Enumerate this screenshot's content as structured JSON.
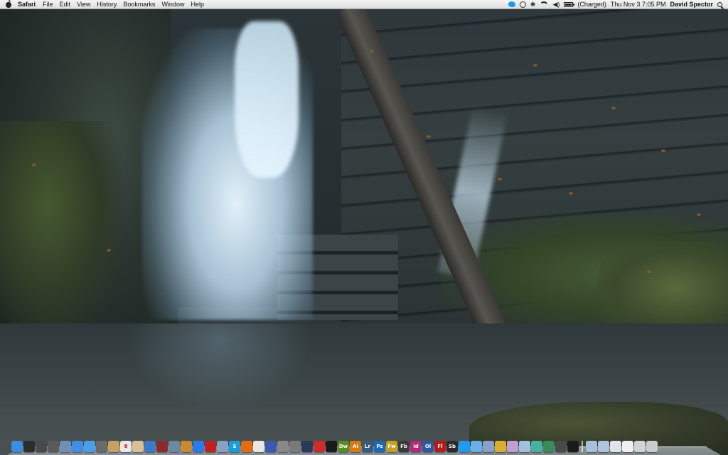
{
  "menubar": {
    "app_name": "Safari",
    "menus": [
      "File",
      "Edit",
      "View",
      "History",
      "Bookmarks",
      "Window",
      "Help"
    ],
    "status": {
      "battery_text": "(Charged)",
      "clock": "Thu Nov 3  7:05 PM",
      "user": "David Spector"
    }
  },
  "dock": {
    "apps": [
      {
        "name": "finder-icon",
        "label": "",
        "color": "#3a8de0"
      },
      {
        "name": "dashboard-icon",
        "label": "",
        "color": "#2d2d2d"
      },
      {
        "name": "mission-control-icon",
        "label": "",
        "color": "#4a4a4a"
      },
      {
        "name": "launchpad-icon",
        "label": "",
        "color": "#5a5a5a"
      },
      {
        "name": "preview-icon",
        "label": "",
        "color": "#6f8fb8"
      },
      {
        "name": "safari-icon",
        "label": "",
        "color": "#3d8fe8"
      },
      {
        "name": "ichat-icon",
        "label": "",
        "color": "#4aa0e8"
      },
      {
        "name": "facetime-icon",
        "label": "",
        "color": "#6a6a6a"
      },
      {
        "name": "contacts-icon",
        "label": "",
        "color": "#c8a060"
      },
      {
        "name": "ical-icon",
        "label": "8",
        "color": "#e8e8e8"
      },
      {
        "name": "preview-photos-icon",
        "label": "",
        "color": "#d8c090"
      },
      {
        "name": "itunes-icon",
        "label": "",
        "color": "#3a7ac8"
      },
      {
        "name": "photo-booth-icon",
        "label": "",
        "color": "#8a2a2a"
      },
      {
        "name": "iphoto-icon",
        "label": "",
        "color": "#6a8aa0"
      },
      {
        "name": "garageband-icon",
        "label": "",
        "color": "#c88a30"
      },
      {
        "name": "app-store-icon",
        "label": "",
        "color": "#2a7ae8"
      },
      {
        "name": "photoshop-elements-icon",
        "label": "",
        "color": "#c02020"
      },
      {
        "name": "mail-icon",
        "label": "",
        "color": "#8aa0c0"
      },
      {
        "name": "skype-icon",
        "label": "S",
        "color": "#14a0e0"
      },
      {
        "name": "firefox-icon",
        "label": "",
        "color": "#e86a10"
      },
      {
        "name": "textedit-icon",
        "label": "",
        "color": "#e8e8e0"
      },
      {
        "name": "xcode-icon",
        "label": "",
        "color": "#3a5ab0"
      },
      {
        "name": "automator-icon",
        "label": "",
        "color": "#888888"
      },
      {
        "name": "system-preferences-icon",
        "label": "",
        "color": "#7a7a7a"
      },
      {
        "name": "quicktime-icon",
        "label": "",
        "color": "#2a3a5a"
      },
      {
        "name": "flash-icon",
        "label": "",
        "color": "#d02a2a"
      },
      {
        "name": "dvd-player-icon",
        "label": "",
        "color": "#1a1a1a"
      },
      {
        "name": "dreamweaver-icon",
        "label": "Dw",
        "color": "#5a8a20"
      },
      {
        "name": "illustrator-icon",
        "label": "Ai",
        "color": "#d87a10"
      },
      {
        "name": "lightroom-icon",
        "label": "Lr",
        "color": "#3a5a7a"
      },
      {
        "name": "photoshop-icon",
        "label": "Ps",
        "color": "#1a6ab8"
      },
      {
        "name": "fireworks-icon",
        "label": "Fw",
        "color": "#c8a020"
      },
      {
        "name": "flash-builder-icon",
        "label": "Fb",
        "color": "#3a3a3a"
      },
      {
        "name": "indesign-icon",
        "label": "Id",
        "color": "#b02a7a"
      },
      {
        "name": "onlocation-icon",
        "label": "Ol",
        "color": "#2a5aa0"
      },
      {
        "name": "flash-pro-icon",
        "label": "Fl",
        "color": "#b81a1a"
      },
      {
        "name": "soundbooth-icon",
        "label": "Sb",
        "color": "#2a2a2a"
      },
      {
        "name": "tweetie-icon",
        "label": "",
        "color": "#1d9bf0"
      },
      {
        "name": "bird-icon",
        "label": "",
        "color": "#6ab0e8"
      },
      {
        "name": "pinwheel-icon",
        "label": "",
        "color": "#8aa0d0"
      },
      {
        "name": "chrome-icon",
        "label": "",
        "color": "#d8b030"
      },
      {
        "name": "growl-icon",
        "label": "",
        "color": "#c0a0d0"
      },
      {
        "name": "stickies-icon",
        "label": "",
        "color": "#a0c0e0"
      },
      {
        "name": "handbrake-icon",
        "label": "",
        "color": "#4ab0a0"
      },
      {
        "name": "globe-icon",
        "label": "",
        "color": "#3a8a5a"
      },
      {
        "name": "activity-monitor-icon",
        "label": "",
        "color": "#4a4a4a"
      },
      {
        "name": "obs-icon",
        "label": "",
        "color": "#1a1a1a"
      }
    ],
    "stacks": [
      {
        "name": "applications-folder-icon",
        "color": "#a8c0e0"
      },
      {
        "name": "documents-folder-icon",
        "color": "#b0c4e0"
      },
      {
        "name": "downloads-stack-icon",
        "color": "#e0e4ea"
      },
      {
        "name": "document-stack-icon",
        "color": "#f0f0f0"
      },
      {
        "name": "screenshot-stack-icon",
        "color": "#d0d4d8"
      },
      {
        "name": "trash-icon",
        "color": "#c8ccd0"
      }
    ]
  }
}
